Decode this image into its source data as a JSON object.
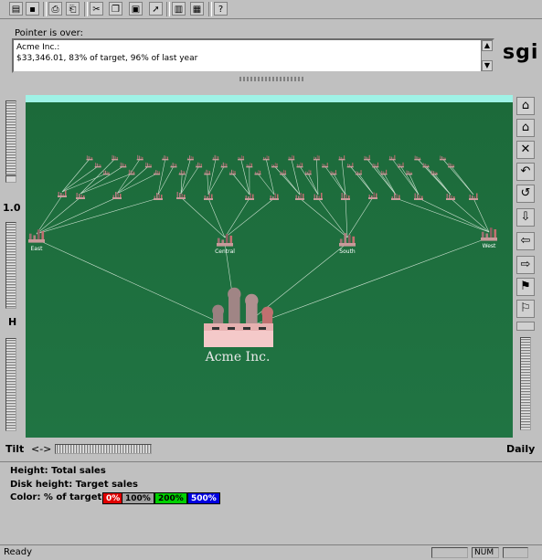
{
  "toolbar": {
    "icons": [
      "open-icon",
      "save-icon",
      "print-icon",
      "print-setup-icon",
      "cut-icon",
      "copy-icon",
      "paste-icon",
      "export-icon",
      "layout-icon",
      "window-icon",
      "help-icon"
    ],
    "help_glyph": "?"
  },
  "hover": {
    "label": "Pointer is over:",
    "line1": "Acme Inc.:",
    "line2": "$33,346.01, 83% of target, 96% of last year",
    "scroll_up": "▲",
    "scroll_down": "▼"
  },
  "logo": "sgi",
  "scene": {
    "root_label": "Acme Inc.",
    "level1_labels": [
      "East",
      "Central",
      "South",
      "West"
    ]
  },
  "left_controls": {
    "scale_value": "1.0",
    "height_label": "H"
  },
  "bottom": {
    "tilt_label": "Tilt",
    "tilt_arrows": "<->",
    "daily_label": "Daily"
  },
  "right_buttons": [
    "home-icon",
    "home-set-icon",
    "grid-icon",
    "back-icon",
    "rotate-icon",
    "down-arrow-icon",
    "left-arrow-icon",
    "right-arrow-icon",
    "flag-icon",
    "flag-back-icon",
    "up-icon"
  ],
  "legend": {
    "height": "Height: Total sales",
    "disk": "Disk height: Target sales",
    "color": "Color: % of target",
    "chips": [
      {
        "label": "0%",
        "bg": "#e00000",
        "fg": "#ffffff"
      },
      {
        "label": "100%",
        "bg": "#a0a0a0",
        "fg": "#000000"
      },
      {
        "label": "200%",
        "bg": "#00d000",
        "fg": "#000000"
      },
      {
        "label": "500%",
        "bg": "#0000e0",
        "fg": "#ffffff"
      }
    ]
  },
  "status": {
    "text": "Ready",
    "num": "NUM"
  }
}
